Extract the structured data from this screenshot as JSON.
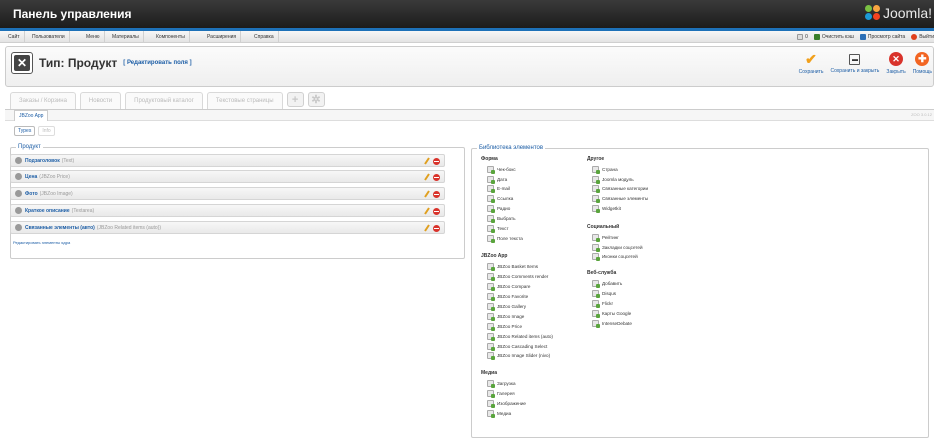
{
  "header": {
    "title": "Панель управления",
    "brand": "Joomla!"
  },
  "menu": [
    "Сайт",
    "Пользователи",
    "Меню",
    "Материалы",
    "Компоненты",
    "Расширения",
    "Справка"
  ],
  "status": {
    "count": "0",
    "clear_cache": "Очистить кэш",
    "view_site": "Просмотр сайта",
    "logout": "Выйти"
  },
  "page": {
    "title": "Тип: Продукт",
    "subtitle": "[ Редактировать поля ]"
  },
  "toolbar": {
    "save": "Сохранить",
    "save_close": "Сохранить и закрыть",
    "close": "Закрыть",
    "help": "Помощь"
  },
  "tabs": [
    "Заказы / Корзина",
    "Новости",
    "Продуктовый каталог",
    "Текстовые страницы"
  ],
  "subtab": "JBZoo App",
  "version": "ZOO 3.0.12",
  "crumbs": [
    "Types",
    "Info"
  ],
  "product": {
    "legend": "Продукт",
    "fields": [
      {
        "name": "Подзаголовок",
        "type": "(Text)"
      },
      {
        "name": "Цена",
        "type": "(JBZoo Price)"
      },
      {
        "name": "Фото",
        "type": "(JBZoo Image)"
      },
      {
        "name": "Краткое описание",
        "type": "(Textarea)"
      },
      {
        "name": "Связанные элементы (авто)",
        "type": "(JBZoo Related items (auto))"
      }
    ],
    "edit_link": "Редактировать элементы ядра"
  },
  "library": {
    "legend": "Библиотека элементов",
    "groups": {
      "form": {
        "title": "Форма",
        "items": [
          "Чек-бокс",
          "Дата",
          "E-mail",
          "Ссылка",
          "Радио",
          "Выбрать",
          "Текст",
          "Поле текста"
        ]
      },
      "jbzoo": {
        "title": "JBZoo App",
        "items": [
          "JBZoo Basket Items",
          "JBZoo Comments render",
          "JBZoo Compare",
          "JBZoo Favorite",
          "JBZoo Gallery",
          "JBZoo Image",
          "JBZoo Price",
          "JBZoo Related items (auto)",
          "JBZoo Cascading Select",
          "JBZoo Image Slider (nivo)"
        ]
      },
      "media": {
        "title": "Медиа",
        "items": [
          "Загрузка",
          "Галерея",
          "Изображение",
          "Медиа"
        ]
      },
      "other": {
        "title": "Другое",
        "items": [
          "Страна",
          "Joomla модуль",
          "Связанные категории",
          "Связанные элементы",
          "Widgetkit"
        ]
      },
      "social": {
        "title": "Социальный",
        "items": [
          "Рейтинг",
          "Закладки соцсетей",
          "Иконки соцсетей"
        ]
      },
      "web": {
        "title": "Веб-служба",
        "items": [
          "Добавить",
          "Disqus",
          "Flickr",
          "Карты Google",
          "IntenseDebate"
        ]
      }
    }
  }
}
